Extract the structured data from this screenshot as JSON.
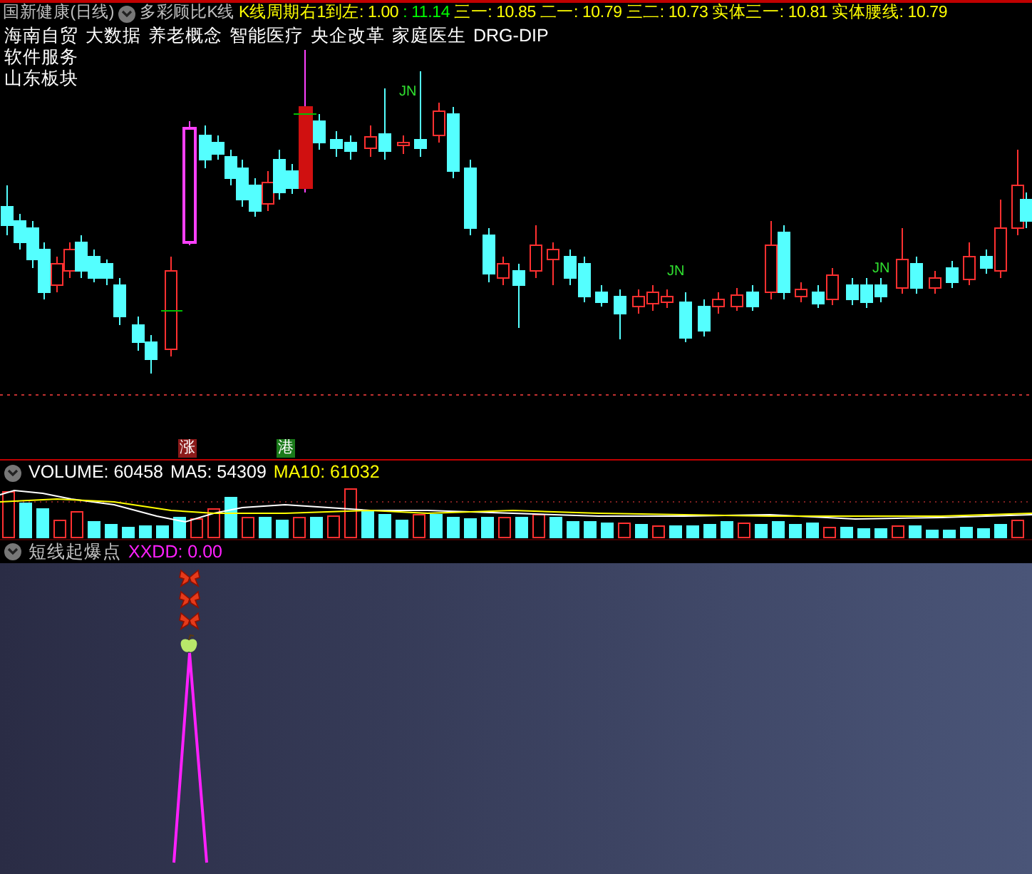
{
  "header": {
    "title": "国新健康(日线)",
    "indicator": "多彩顾比K线",
    "values": [
      {
        "text": "K线周期右1到左: 1.00",
        "color": "#ffff00"
      },
      {
        "text": ": 11.14",
        "color": "#00ff00"
      },
      {
        "text": "三一: 10.85",
        "color": "#ffff00"
      },
      {
        "text": "二一: 10.79",
        "color": "#ffff00"
      },
      {
        "text": "三二: 10.73",
        "color": "#ffff00"
      },
      {
        "text": "实体三一: 10.81",
        "color": "#ffff00"
      },
      {
        "text": "实体腰线: 10.79",
        "color": "#ffff00"
      }
    ]
  },
  "concept_tags": [
    [
      "海南自贸",
      "大数据",
      "养老概念",
      "智能医疗",
      "央企改革",
      "家庭医生",
      "DRG-DIP"
    ],
    [
      "软件服务"
    ],
    [
      "山东板块"
    ]
  ],
  "chart_labels": [
    {
      "text": "JN"
    },
    {
      "text": "JN"
    },
    {
      "text": "JN"
    }
  ],
  "badges": [
    {
      "text": "涨",
      "color": "#8b1a1a"
    },
    {
      "text": "港",
      "color": "#1a7a1a"
    }
  ],
  "volume_panel": {
    "values": [
      {
        "text": "VOLUME: 60458",
        "color": "#ffffff"
      },
      {
        "text": "MA5: 54309",
        "color": "#ffffff"
      },
      {
        "text": "MA10: 61032",
        "color": "#ffff00"
      }
    ]
  },
  "signal_panel": {
    "title": "短线起爆点",
    "value": "XXDD: 0.00"
  }
}
